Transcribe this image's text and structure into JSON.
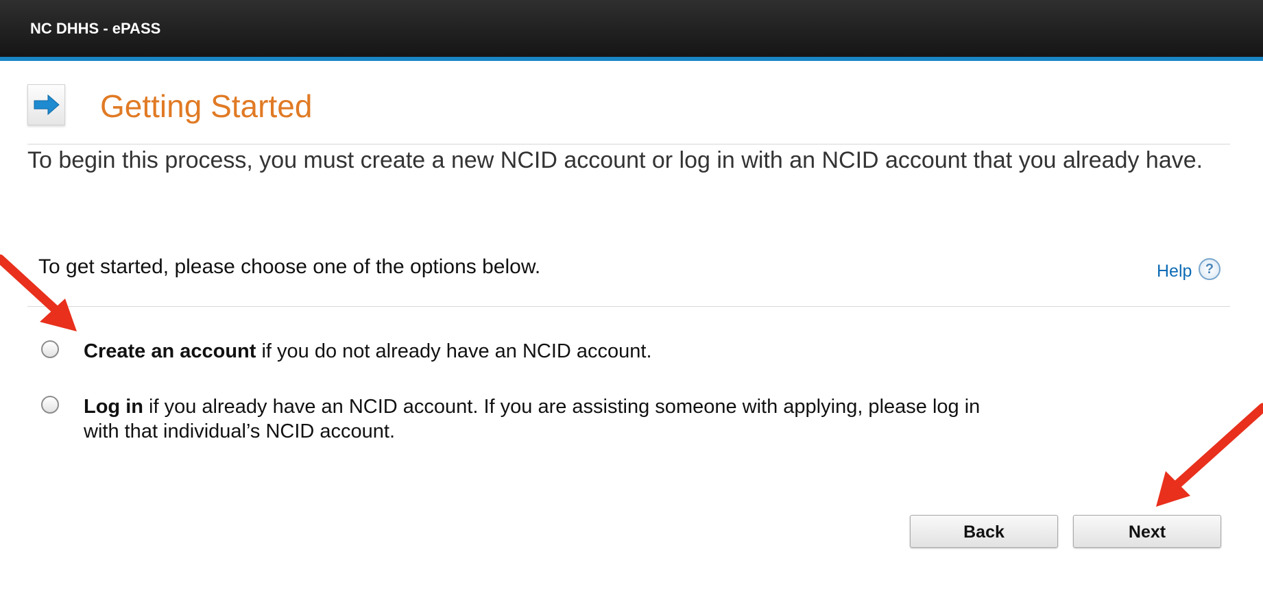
{
  "header": {
    "app_title": "NC DHHS - ePASS"
  },
  "page": {
    "icon": "arrow-right-icon",
    "title": "Getting Started",
    "intro": "To begin this process, you must create a new NCID account or log in with an NCID account that you already have."
  },
  "options_section": {
    "prompt": "To get started, please choose one of the options below.",
    "help_label": "Help",
    "help_icon": "question-mark-icon",
    "options": [
      {
        "bold": "Create an account",
        "rest": " if you do not already have an NCID account.",
        "selected": false
      },
      {
        "bold": "Log in",
        "rest": " if you already have an NCID account. If you are assisting someone with applying, please log in with that individual’s NCID account.",
        "selected": false
      }
    ]
  },
  "buttons": {
    "back_label": "Back",
    "next_label": "Next"
  },
  "colors": {
    "header_bg": "#1f1f1f",
    "header_accent": "#1a86c6",
    "title_orange": "#e07a24",
    "link_blue": "#0d6bb5",
    "annotation_red": "#e8301c"
  }
}
